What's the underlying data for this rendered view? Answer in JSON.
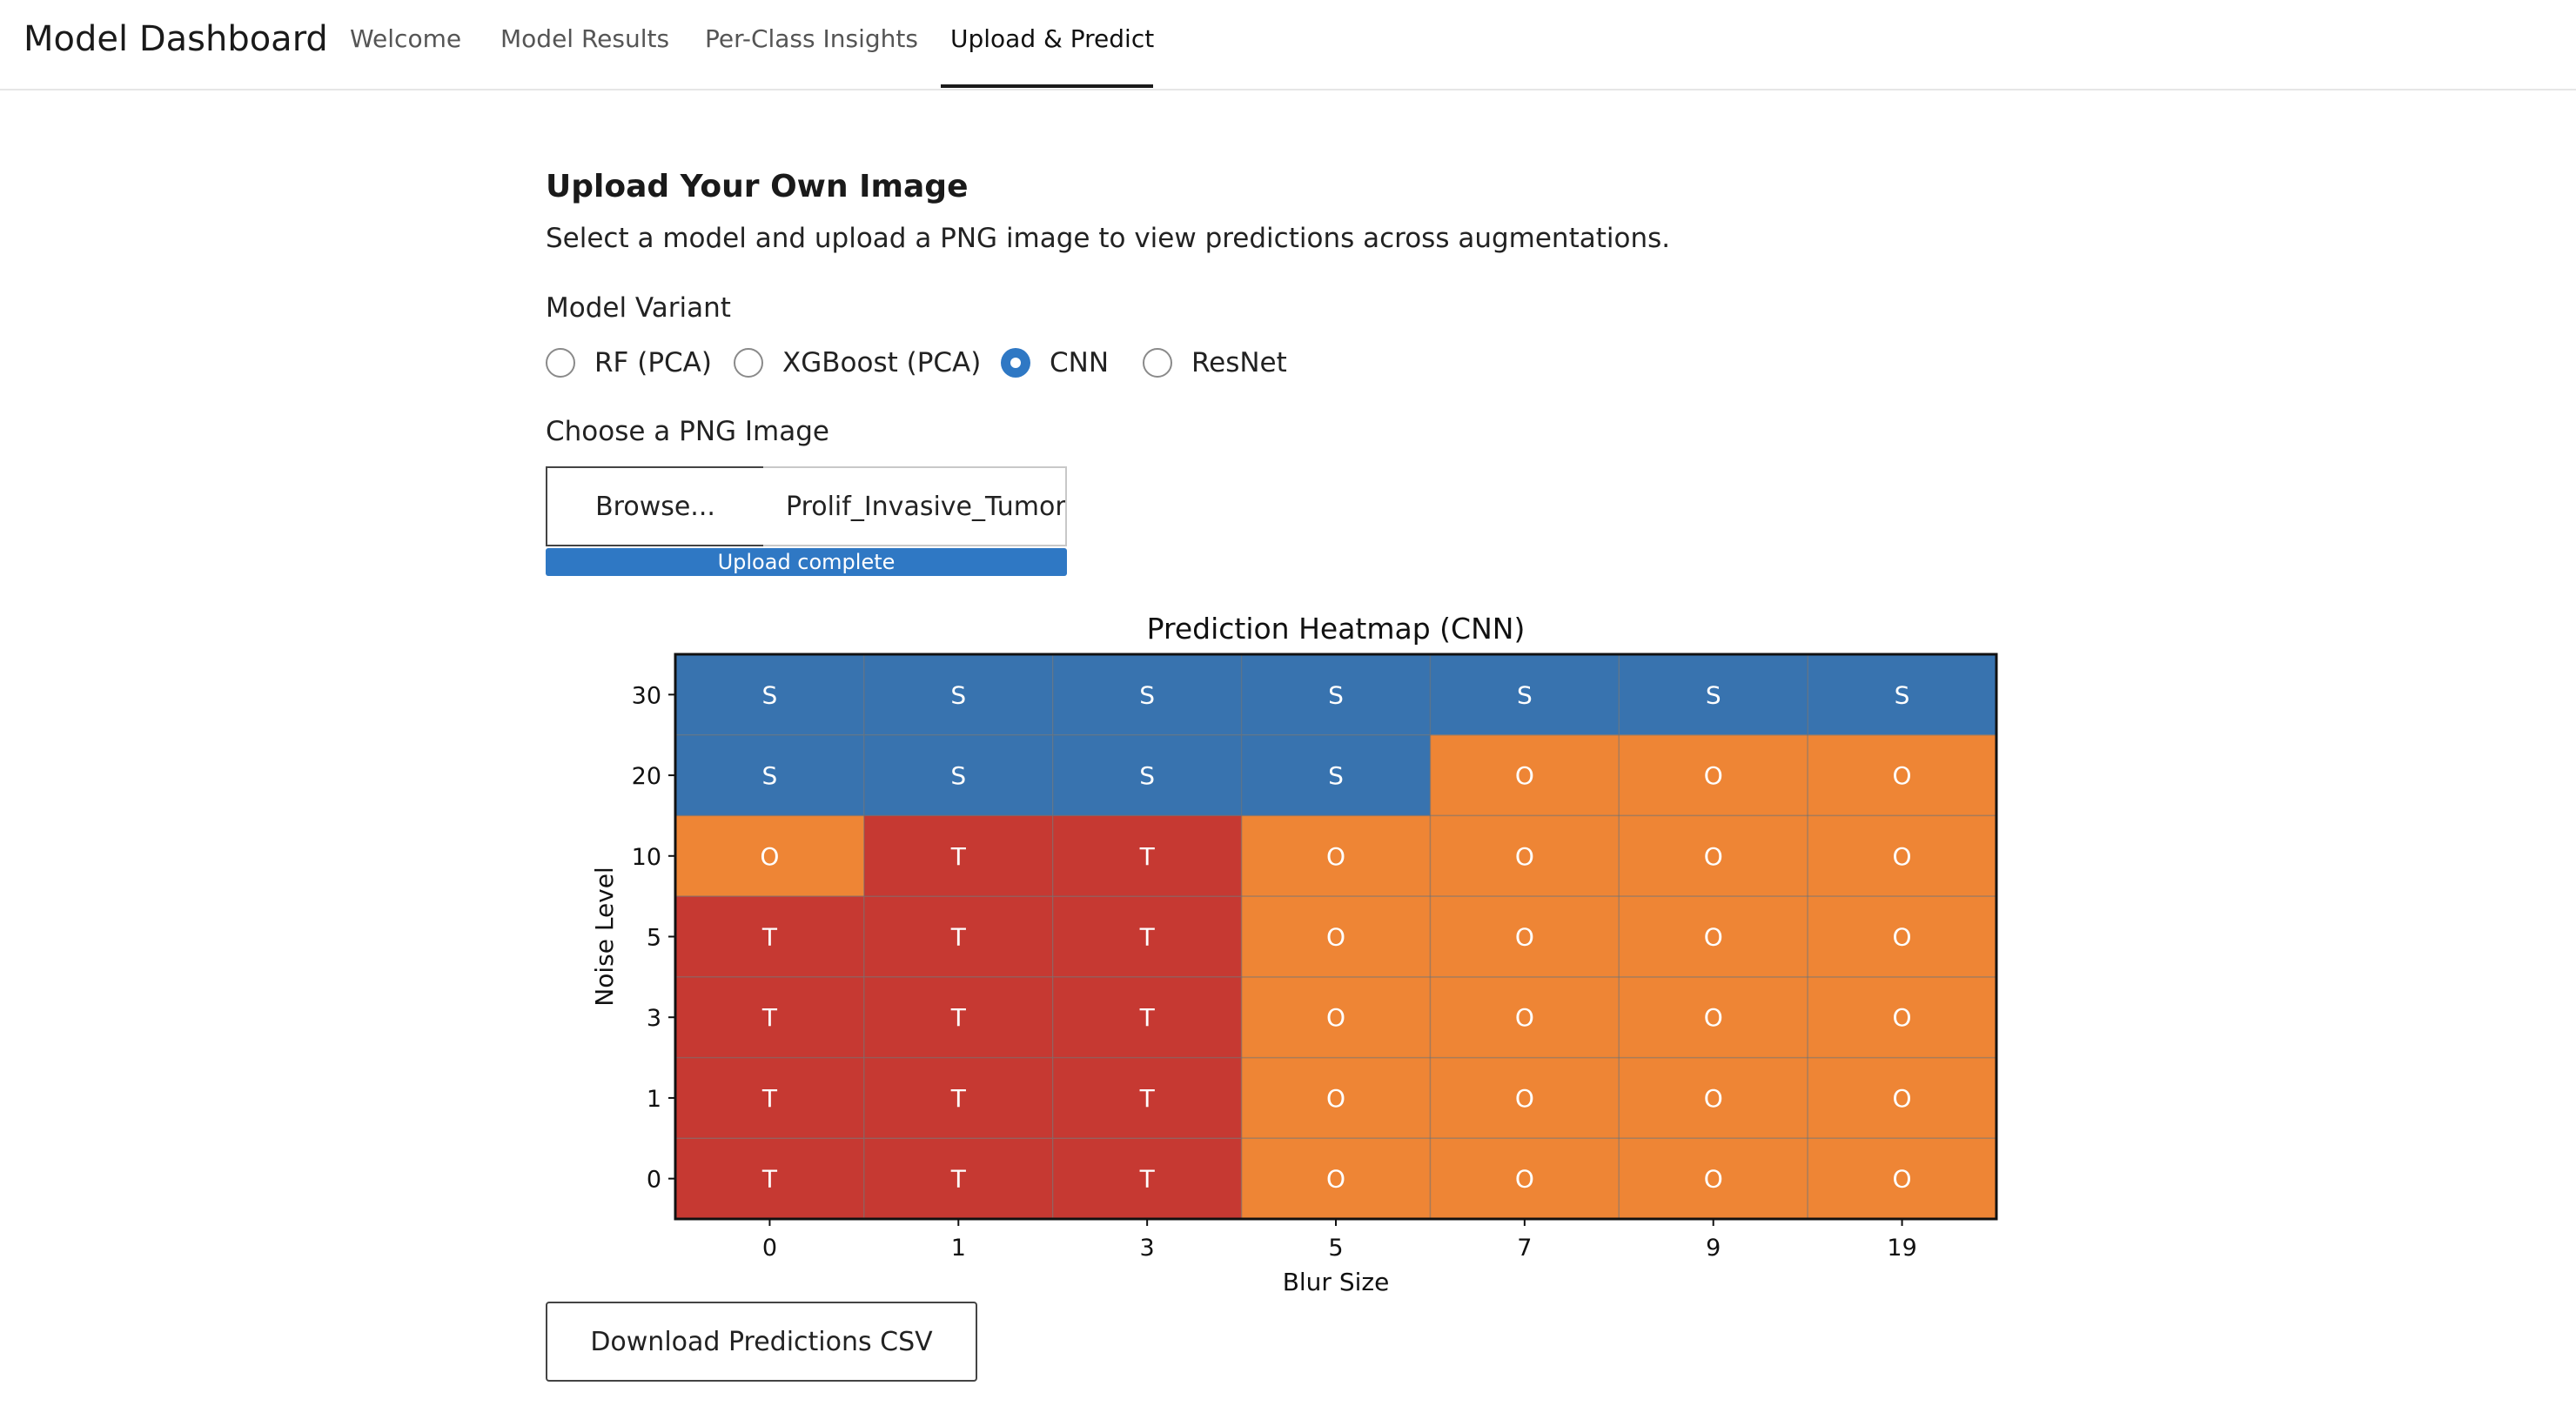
{
  "app": {
    "brand": "Model Dashboard"
  },
  "nav": {
    "tabs": [
      {
        "label": "Welcome",
        "active": false
      },
      {
        "label": "Model Results",
        "active": false
      },
      {
        "label": "Per-Class Insights",
        "active": false
      },
      {
        "label": "Upload & Predict",
        "active": true
      }
    ]
  },
  "upload": {
    "title": "Upload Your Own Image",
    "description": "Select a model and upload a PNG image to view predictions across augmentations.",
    "model_variant_label": "Model Variant",
    "model_options": [
      {
        "label": "RF (PCA)",
        "selected": false
      },
      {
        "label": "XGBoost (PCA)",
        "selected": false
      },
      {
        "label": "CNN",
        "selected": true
      },
      {
        "label": "ResNet",
        "selected": false
      }
    ],
    "file_label": "Choose a PNG Image",
    "browse_label": "Browse...",
    "file_name": "Prolif_Invasive_Tumor",
    "progress_text": "Upload complete",
    "progress": 1.0
  },
  "download": {
    "label": "Download Predictions CSV"
  },
  "chart_data": {
    "type": "heatmap",
    "title": "Prediction Heatmap (CNN)",
    "xlabel": "Blur Size",
    "ylabel": "Noise Level",
    "x_categories": [
      "0",
      "1",
      "3",
      "5",
      "7",
      "9",
      "19"
    ],
    "y_categories": [
      "30",
      "20",
      "10",
      "5",
      "3",
      "1",
      "0"
    ],
    "cells": [
      [
        "S",
        "S",
        "S",
        "S",
        "S",
        "S",
        "S"
      ],
      [
        "S",
        "S",
        "S",
        "S",
        "O",
        "O",
        "O"
      ],
      [
        "O",
        "T",
        "T",
        "O",
        "O",
        "O",
        "O"
      ],
      [
        "T",
        "T",
        "T",
        "O",
        "O",
        "O",
        "O"
      ],
      [
        "T",
        "T",
        "T",
        "O",
        "O",
        "O",
        "O"
      ],
      [
        "T",
        "T",
        "T",
        "O",
        "O",
        "O",
        "O"
      ],
      [
        "T",
        "T",
        "T",
        "O",
        "O",
        "O",
        "O"
      ]
    ],
    "class_colors": {
      "S": "#3873af",
      "O": "#ee8535",
      "T": "#c63932"
    },
    "grid": true
  }
}
